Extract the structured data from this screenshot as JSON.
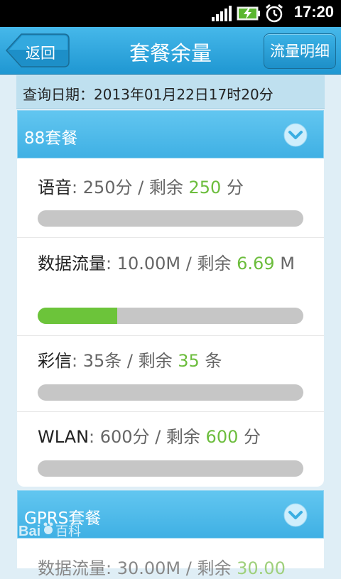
{
  "status_bar": {
    "time": "17:20"
  },
  "header": {
    "back_label": "返回",
    "title": "套餐余量",
    "detail_label": "流量明细"
  },
  "query": {
    "text": "查询日期：2013年01月22日17时20分"
  },
  "packages": [
    {
      "name": "88套餐",
      "items": [
        {
          "name": "语音",
          "total": "250分",
          "remain_prefix": " / 剩余 ",
          "remain": "250",
          "unit": " 分",
          "remaining_fraction": 0
        },
        {
          "name": "数据流量",
          "total": "10.00M",
          "remain_prefix": " / 剩余 ",
          "remain": "6.69",
          "unit": " M",
          "remaining_fraction": 0.3
        },
        {
          "name": "彩信",
          "total": "35条",
          "remain_prefix": " / 剩余 ",
          "remain": "35",
          "unit": " 条",
          "remaining_fraction": 0
        },
        {
          "name": "WLAN",
          "total": "600分",
          "remain_prefix": " / 剩余 ",
          "remain": "600",
          "unit": " 分",
          "remaining_fraction": 0
        }
      ]
    },
    {
      "name": "GPRS套餐",
      "items": [
        {
          "name": "数据流量",
          "total": "30.00M",
          "remain_prefix": " / 剩余 ",
          "remain": "30.00"
        }
      ]
    }
  ],
  "colors": {
    "accent": "#2aa3dd",
    "remain": "#6cbd3d",
    "bar_fill": "#6cc43a",
    "bar_track": "#c6c6c6"
  },
  "watermark": {
    "text": "Baidu百科"
  }
}
